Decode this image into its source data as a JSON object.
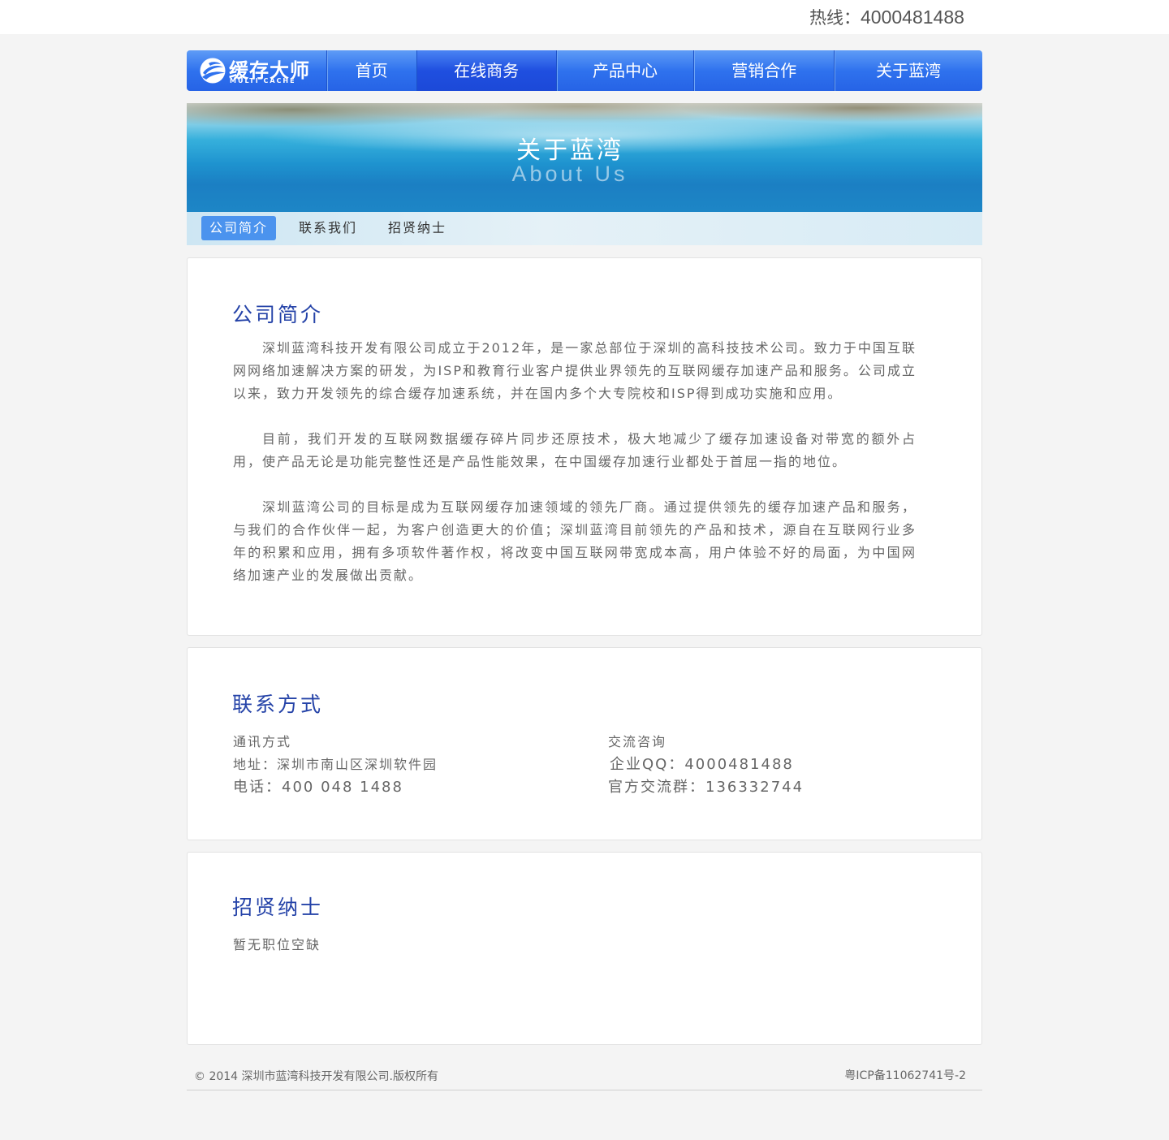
{
  "hotline": {
    "label": "热线：",
    "number": "4000481488"
  },
  "nav": {
    "logo_text": "缓存大师",
    "logo_sub": "MULTI CACHE",
    "items": [
      {
        "label": "首页"
      },
      {
        "label": "在线商务"
      },
      {
        "label": "产品中心"
      },
      {
        "label": "营销合作"
      },
      {
        "label": "关于蓝湾"
      }
    ],
    "active_index": 1
  },
  "banner": {
    "title": "关于蓝湾",
    "subtitle": "About Us"
  },
  "subtabs": [
    {
      "label": "公司简介"
    },
    {
      "label": "联系我们"
    },
    {
      "label": "招贤纳士"
    }
  ],
  "intro": {
    "title": "公司简介",
    "paragraphs": [
      "深圳蓝湾科技开发有限公司成立于2012年，是一家总部位于深圳的高科技技术公司。致力于中国互联网网络加速解决方案的研发，为ISP和教育行业客户提供业界领先的互联网缓存加速产品和服务。公司成立以来，致力开发领先的综合缓存加速系统，并在国内多个大专院校和ISP得到成功实施和应用。",
      "目前，我们开发的互联网数据缓存碎片同步还原技术，极大地减少了缓存加速设备对带宽的额外占用，使产品无论是功能完整性还是产品性能效果，在中国缓存加速行业都处于首屈一指的地位。",
      "深圳蓝湾公司的目标是成为互联网缓存加速领域的领先厂商。通过提供领先的缓存加速产品和服务，与我们的合作伙伴一起，为客户创造更大的价值；深圳蓝湾目前领先的产品和技术，源自在互联网行业多年的积累和应用，拥有多项软件著作权，将改变中国互联网带宽成本高，用户体验不好的局面，为中国网络加速产业的发展做出贡献。"
    ]
  },
  "contact": {
    "title": "联系方式",
    "left_heading": "通讯方式",
    "address": "地址：深圳市南山区深圳软件园",
    "phone": "电话：400 048 1488",
    "right_heading": "交流咨询",
    "qq": "企业QQ：4000481488",
    "group": "官方交流群：136332744"
  },
  "jobs": {
    "title": "招贤纳士",
    "text": "暂无职位空缺"
  },
  "footer": {
    "copyright": "© 2014 深圳市蓝湾科技开发有限公司.版权所有",
    "icp": "粤ICP备11062741号-2"
  },
  "colors": {
    "nav_blue": "#2f72ee",
    "heading_blue": "#2543a8",
    "subtab_active": "#4b93ee"
  }
}
